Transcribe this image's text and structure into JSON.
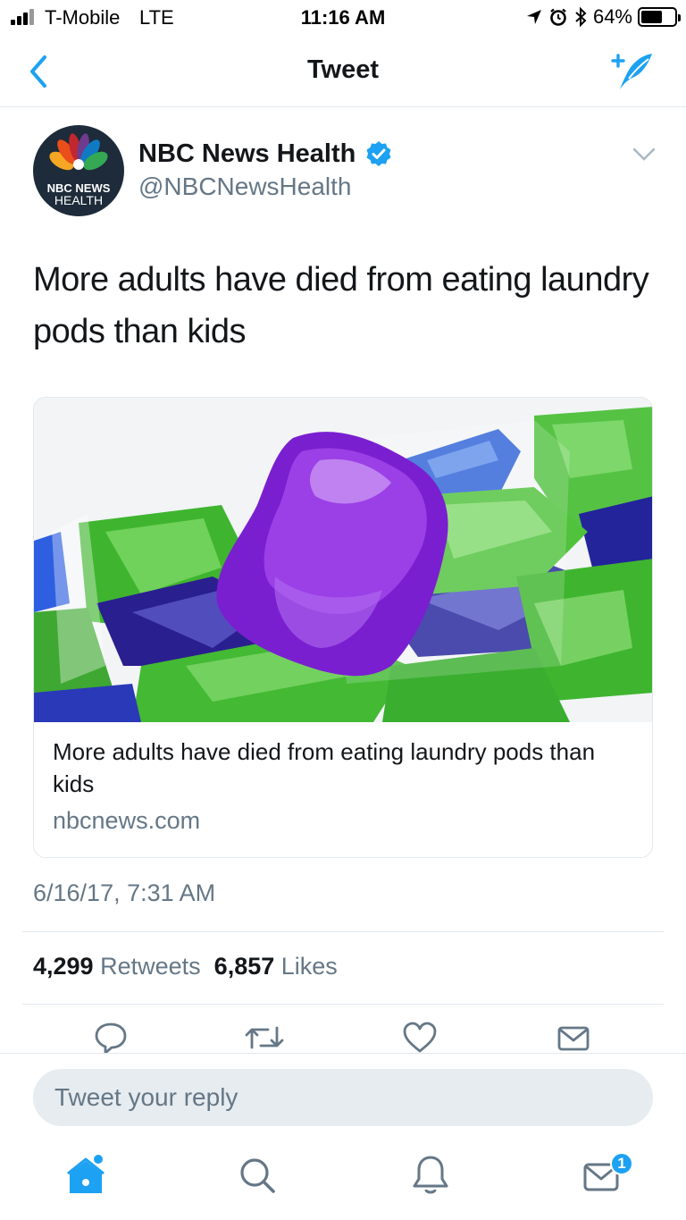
{
  "status_bar": {
    "carrier": "T-Mobile",
    "network": "LTE",
    "time": "11:16 AM",
    "battery_percent": "64%",
    "battery_level": 0.64,
    "icons": [
      "location-arrow-icon",
      "alarm-icon",
      "bluetooth-icon",
      "battery-icon"
    ]
  },
  "nav": {
    "title": "Tweet",
    "back_icon": "chevron-left-icon",
    "compose_icon": "compose-tweet-icon"
  },
  "tweet": {
    "author_name": "NBC News Health",
    "author_handle": "@NBCNewsHealth",
    "avatar_line1": "NBC NEWS",
    "avatar_line2": "HEALTH",
    "verified": true,
    "text": "More adults have died from eating laundry pods than kids",
    "card": {
      "title": "More adults have died from eating laundry pods than kids",
      "domain": "nbcnews.com"
    },
    "timestamp": "6/16/17, 7:31 AM",
    "retweets_count": "4,299",
    "retweets_label": "Retweets",
    "likes_count": "6,857",
    "likes_label": "Likes"
  },
  "actions": [
    "reply-icon",
    "retweet-icon",
    "like-icon",
    "direct-message-icon"
  ],
  "reply": {
    "placeholder": "Tweet your reply"
  },
  "tab_bar": {
    "items": [
      "home-icon",
      "search-icon",
      "notifications-icon",
      "messages-icon"
    ],
    "messages_badge": "1"
  },
  "colors": {
    "accent": "#1da1f2",
    "text_primary": "#14171a",
    "text_secondary": "#657786",
    "border": "#e1e8ed"
  }
}
